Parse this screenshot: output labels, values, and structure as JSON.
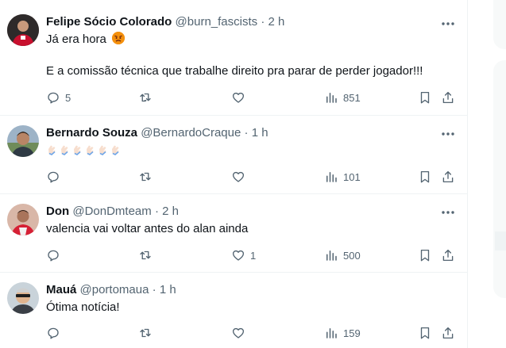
{
  "tweets": [
    {
      "name": "Felipe Sócio Colorado",
      "handle": "@burn_fascists",
      "sep": "·",
      "time": "2 h",
      "line1": "Já era hora",
      "line2": "E a comissão técnica que trabalhe direito pra parar de perder jogador!!!",
      "replies": "5",
      "likes": "",
      "views": "851",
      "emoji": "angry-face"
    },
    {
      "name": "Bernardo Souza",
      "handle": "@BernardoCraque",
      "sep": "·",
      "time": "1 h",
      "line1": "",
      "replies": "",
      "likes": "",
      "views": "101",
      "emoji": "clapping-hands x6"
    },
    {
      "name": "Don",
      "handle": "@DonDmteam",
      "sep": "·",
      "time": "2 h",
      "line1": "valencia vai voltar antes do alan ainda",
      "replies": "",
      "likes": "1",
      "views": "500"
    },
    {
      "name": "Mauá",
      "handle": "@portomaua",
      "sep": "·",
      "time": "1 h",
      "line1": "Ótima notícia!",
      "replies": "",
      "likes": "",
      "views": "159"
    }
  ],
  "icons": {
    "reply": "speech-bubble-icon",
    "retweet": "retweet-icon",
    "like": "heart-icon",
    "views": "bar-chart-icon",
    "bookmark": "bookmark-icon",
    "share": "share-icon",
    "more": "more-dots-icon"
  },
  "colors": {
    "text": "#0f1419",
    "muted": "#536471",
    "divider": "#eff3f4"
  }
}
